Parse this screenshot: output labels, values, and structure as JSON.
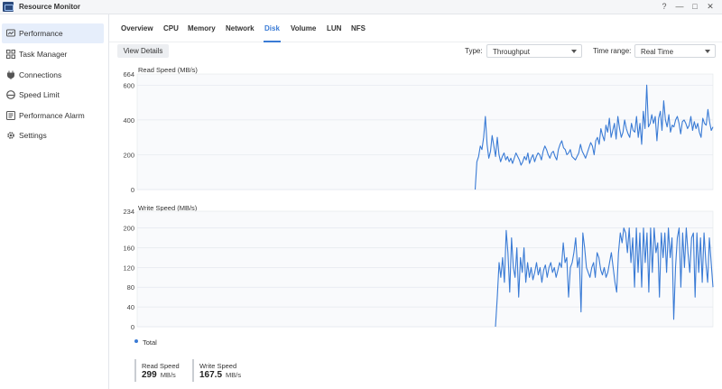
{
  "window": {
    "title": "Resource Monitor",
    "controls": {
      "help": "?",
      "minimize": "—",
      "maximize": "□",
      "close": "✕"
    },
    "icon": "resource-monitor-icon"
  },
  "sidebar": {
    "items": [
      {
        "label": "Performance",
        "icon": "performance-icon",
        "active": true
      },
      {
        "label": "Task Manager",
        "icon": "task-manager-icon"
      },
      {
        "label": "Connections",
        "icon": "connections-icon"
      },
      {
        "label": "Speed Limit",
        "icon": "speed-limit-icon"
      },
      {
        "label": "Performance Alarm",
        "icon": "alarm-icon"
      },
      {
        "label": "Settings",
        "icon": "gear-icon"
      }
    ]
  },
  "tabs": [
    "Overview",
    "CPU",
    "Memory",
    "Network",
    "Disk",
    "Volume",
    "LUN",
    "NFS"
  ],
  "active_tab": "Disk",
  "toolbar": {
    "view_details": "View Details",
    "type_label": "Type:",
    "type_value": "Throughput",
    "time_range_label": "Time range:",
    "time_range_value": "Real Time"
  },
  "colors": {
    "accent": "#3a7bd5",
    "line": "#3a7bd5",
    "grid": "#e5e8ee",
    "plot_bg": "#f9fafc"
  },
  "chart_data": [
    {
      "type": "line",
      "title": "Read Speed (MB/s)",
      "ylim": [
        0,
        664
      ],
      "ymax_label": "664",
      "yticks": [
        0,
        200,
        400,
        600
      ],
      "series": [
        {
          "name": "Total",
          "values": [
            0,
            0,
            0,
            0,
            0,
            0,
            0,
            0,
            0,
            0,
            0,
            0,
            0,
            0,
            0,
            0,
            0,
            0,
            0,
            0,
            0,
            0,
            0,
            0,
            0,
            0,
            0,
            0,
            0,
            0,
            0,
            0,
            0,
            0,
            0,
            0,
            0,
            0,
            0,
            0,
            0,
            0,
            0,
            0,
            0,
            0,
            0,
            0,
            0,
            0,
            0,
            0,
            0,
            0,
            0,
            0,
            0,
            0,
            0,
            0,
            0,
            0,
            0,
            0,
            0,
            0,
            0,
            0,
            0,
            0,
            0,
            0,
            0,
            0,
            0,
            0,
            0,
            0,
            0,
            0,
            0,
            0,
            0,
            0,
            0,
            0,
            0,
            0,
            0,
            0,
            0,
            0,
            0,
            0,
            0,
            0,
            0,
            0,
            0,
            0,
            0,
            0,
            0,
            0,
            0,
            0,
            0,
            0,
            0,
            0,
            0,
            0,
            0,
            0,
            0,
            0,
            0,
            0,
            0,
            0,
            0,
            0,
            0,
            0,
            0,
            0,
            0,
            0,
            0,
            0,
            0,
            0,
            0,
            0,
            0,
            0,
            0,
            0,
            0,
            0,
            0,
            0,
            0,
            0,
            0,
            0,
            0,
            0,
            0,
            0,
            0,
            0,
            0,
            0,
            0,
            0,
            0,
            0,
            0,
            0,
            0,
            0,
            0,
            0,
            0,
            0,
            0,
            0,
            0,
            0,
            0,
            0,
            0,
            0,
            0,
            0,
            0,
            0,
            0,
            0,
            0,
            0,
            0,
            0,
            0,
            0,
            0,
            0,
            0,
            0,
            0,
            0,
            0,
            0,
            0,
            0,
            0,
            0,
            0,
            0,
            160,
            190,
            250,
            230,
            300,
            420,
            260,
            180,
            220,
            310,
            250,
            190,
            300,
            200,
            160,
            190,
            210,
            170,
            190,
            160,
            180,
            150,
            180,
            210,
            190,
            170,
            140,
            160,
            190,
            170,
            210,
            150,
            180,
            200,
            160,
            190,
            210,
            200,
            170,
            220,
            250,
            230,
            200,
            180,
            210,
            220,
            190,
            170,
            230,
            260,
            280,
            240,
            230,
            200,
            210,
            230,
            190,
            180,
            170,
            190,
            210,
            260,
            220,
            200,
            180,
            210,
            240,
            270,
            250,
            200,
            280,
            300,
            260,
            350,
            310,
            280,
            370,
            330,
            410,
            300,
            340,
            380,
            290,
            420,
            350,
            300,
            330,
            400,
            350,
            320,
            300,
            380,
            340,
            330,
            420,
            300,
            380,
            260,
            450,
            350,
            600,
            360,
            380,
            430,
            380,
            420,
            280,
            410,
            450,
            340,
            510,
            400,
            360,
            430,
            330,
            370,
            360,
            400,
            420,
            380,
            320,
            390,
            400,
            380,
            350,
            370,
            420,
            340,
            390,
            350,
            380,
            330,
            300,
            410,
            380,
            370,
            460,
            390,
            340,
            360
          ]
        }
      ]
    },
    {
      "type": "line",
      "title": "Write Speed (MB/s)",
      "ylim": [
        0,
        234
      ],
      "ymax_label": "234",
      "yticks": [
        0,
        40,
        80,
        120,
        160,
        200
      ],
      "series": [
        {
          "name": "Total",
          "values": [
            0,
            0,
            0,
            0,
            0,
            0,
            0,
            0,
            0,
            0,
            0,
            0,
            0,
            0,
            0,
            0,
            0,
            0,
            0,
            0,
            0,
            0,
            0,
            0,
            0,
            0,
            0,
            0,
            0,
            0,
            0,
            0,
            0,
            0,
            0,
            0,
            0,
            0,
            0,
            0,
            0,
            0,
            0,
            0,
            0,
            0,
            0,
            0,
            0,
            0,
            0,
            0,
            0,
            0,
            0,
            0,
            0,
            0,
            0,
            0,
            0,
            0,
            0,
            0,
            0,
            0,
            0,
            0,
            0,
            0,
            0,
            0,
            0,
            0,
            0,
            0,
            0,
            0,
            0,
            0,
            0,
            0,
            0,
            0,
            0,
            0,
            0,
            0,
            0,
            0,
            0,
            0,
            0,
            0,
            0,
            0,
            0,
            0,
            0,
            0,
            0,
            0,
            0,
            0,
            0,
            0,
            0,
            0,
            0,
            0,
            0,
            0,
            0,
            0,
            0,
            0,
            0,
            0,
            0,
            0,
            0,
            0,
            0,
            0,
            0,
            0,
            0,
            0,
            0,
            0,
            0,
            0,
            0,
            0,
            0,
            0,
            0,
            0,
            0,
            0,
            0,
            0,
            0,
            0,
            0,
            0,
            0,
            0,
            0,
            0,
            0,
            0,
            0,
            0,
            0,
            0,
            0,
            0,
            0,
            0,
            0,
            0,
            0,
            0,
            0,
            0,
            0,
            0,
            0,
            0,
            0,
            0,
            0,
            0,
            0,
            0,
            0,
            0,
            0,
            0,
            0,
            0,
            0,
            0,
            0,
            0,
            0,
            0,
            0,
            0,
            0,
            0,
            0,
            0,
            0,
            0,
            0,
            0,
            0,
            0,
            0,
            0,
            60,
            130,
            100,
            140,
            90,
            195,
            150,
            70,
            180,
            120,
            100,
            160,
            60,
            140,
            110,
            160,
            90,
            130,
            100,
            120,
            95,
            110,
            130,
            105,
            120,
            90,
            115,
            125,
            100,
            120,
            130,
            110,
            120,
            100,
            115,
            130,
            120,
            170,
            130,
            140,
            60,
            120,
            130,
            150,
            180,
            120,
            140,
            30,
            190,
            160,
            120,
            110,
            100,
            120,
            130,
            100,
            150,
            140,
            115,
            105,
            120,
            100,
            110,
            130,
            150,
            120,
            90,
            70,
            150,
            190,
            170,
            200,
            190,
            150,
            200,
            130,
            180,
            80,
            200,
            110,
            190,
            80,
            200,
            130,
            190,
            70,
            200,
            110,
            200,
            150,
            170,
            60,
            190,
            140,
            190,
            110,
            200,
            140,
            180,
            15,
            120,
            180,
            200,
            80,
            190,
            120,
            200,
            150,
            110,
            180,
            190,
            60,
            190,
            110,
            180,
            90,
            190,
            130,
            90,
            180,
            130,
            80
          ]
        }
      ]
    }
  ],
  "legend": {
    "label": "Total"
  },
  "stats": [
    {
      "label": "Read Speed",
      "value": "299",
      "unit": "MB/s"
    },
    {
      "label": "Write Speed",
      "value": "167.5",
      "unit": "MB/s"
    }
  ]
}
